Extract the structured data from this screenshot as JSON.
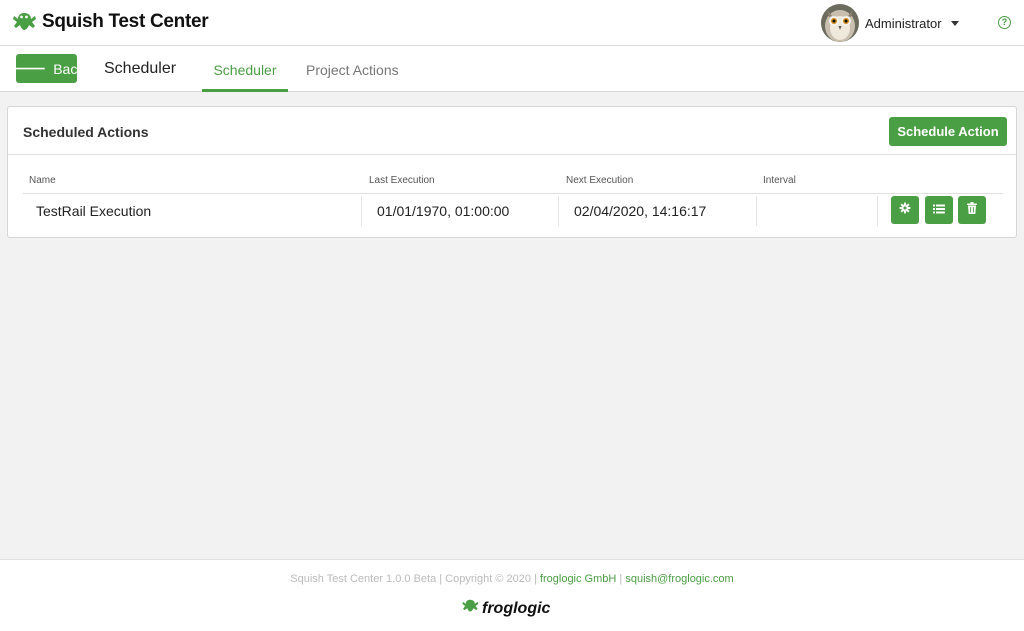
{
  "header": {
    "app_name": "Squish Test Center",
    "user_name": "Administrator",
    "help_icon": "?"
  },
  "subheader": {
    "back_label": "Back",
    "page_title": "Scheduler",
    "tabs": [
      {
        "label": "Scheduler",
        "active": true
      },
      {
        "label": "Project Actions",
        "active": false
      }
    ]
  },
  "panel": {
    "title": "Scheduled Actions",
    "schedule_button": "Schedule Action",
    "columns": [
      "Name",
      "Last Execution",
      "Next Execution",
      "Interval"
    ],
    "rows": [
      {
        "name": "TestRail Execution",
        "last_execution": "01/01/1970, 01:00:00",
        "next_execution": "02/04/2020, 14:16:17",
        "interval": "",
        "actions": [
          "gear-icon",
          "list-icon",
          "trash-icon"
        ]
      }
    ]
  },
  "footer": {
    "text": "Squish Test Center 1.0.0 Beta | Copyright © 2020 |",
    "company_link": "froglogic GmbH",
    "separator": "|",
    "email_link": "squish@froglogic.com",
    "brand": "froglogic"
  },
  "colors": {
    "accent": "#4a9e43",
    "background": "#f2f2f2"
  }
}
